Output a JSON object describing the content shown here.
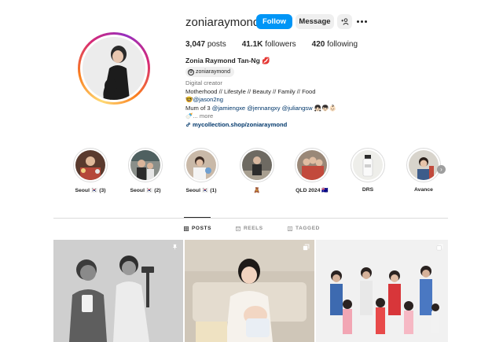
{
  "profile": {
    "username": "zoniaraymond",
    "verified": true,
    "actions": {
      "follow_label": "Follow",
      "message_label": "Message",
      "suggest_icon": "person-add-icon",
      "more_icon": "more-horizontal-icon"
    },
    "stats": {
      "posts_count": "3,047",
      "posts_label": "posts",
      "followers_count": "41.1K",
      "followers_label": "followers",
      "following_count": "420",
      "following_label": "following"
    },
    "full_name": "Zonia Raymond Tan-Ng 💋",
    "threads_handle": "zoniaraymond",
    "bio": {
      "category": "Digital creator",
      "line1": "Motherhood // Lifestyle // Beauty // Family // Food",
      "line2_prefix": "🤓",
      "line2_mention": "@jason2ng",
      "line3_prefix": "Mum of 3 ",
      "line3_mentions": "@jamiengxe @jennangxy @juliangsw",
      "line3_suffix": " 👧🏻👦🏻👶🏻",
      "more_prefix": "🍼... ",
      "more_label": "more",
      "link": "mycollection.shop/zoniaraymond"
    }
  },
  "highlights": [
    {
      "label": "Seoul 🇰🇷 (3)"
    },
    {
      "label": "Seoul 🇰🇷 (2)"
    },
    {
      "label": "Seoul 🇰🇷 (1)"
    },
    {
      "label": "🧸"
    },
    {
      "label": "QLD 2024 🇦🇺"
    },
    {
      "label": "DRS"
    },
    {
      "label": "Avance"
    }
  ],
  "tabs": [
    {
      "label": "POSTS",
      "active": true,
      "icon": "grid-icon"
    },
    {
      "label": "REELS",
      "active": false,
      "icon": "reels-icon"
    },
    {
      "label": "TAGGED",
      "active": false,
      "icon": "tagged-icon"
    }
  ],
  "posts": [
    {
      "badge": "pinned-icon"
    },
    {
      "badge": "carousel-icon"
    },
    {
      "badge": "carousel-icon"
    }
  ],
  "colors": {
    "primary_button": "#0095f6",
    "secondary_button": "#efefef",
    "link": "#00376b",
    "muted": "#737373"
  }
}
